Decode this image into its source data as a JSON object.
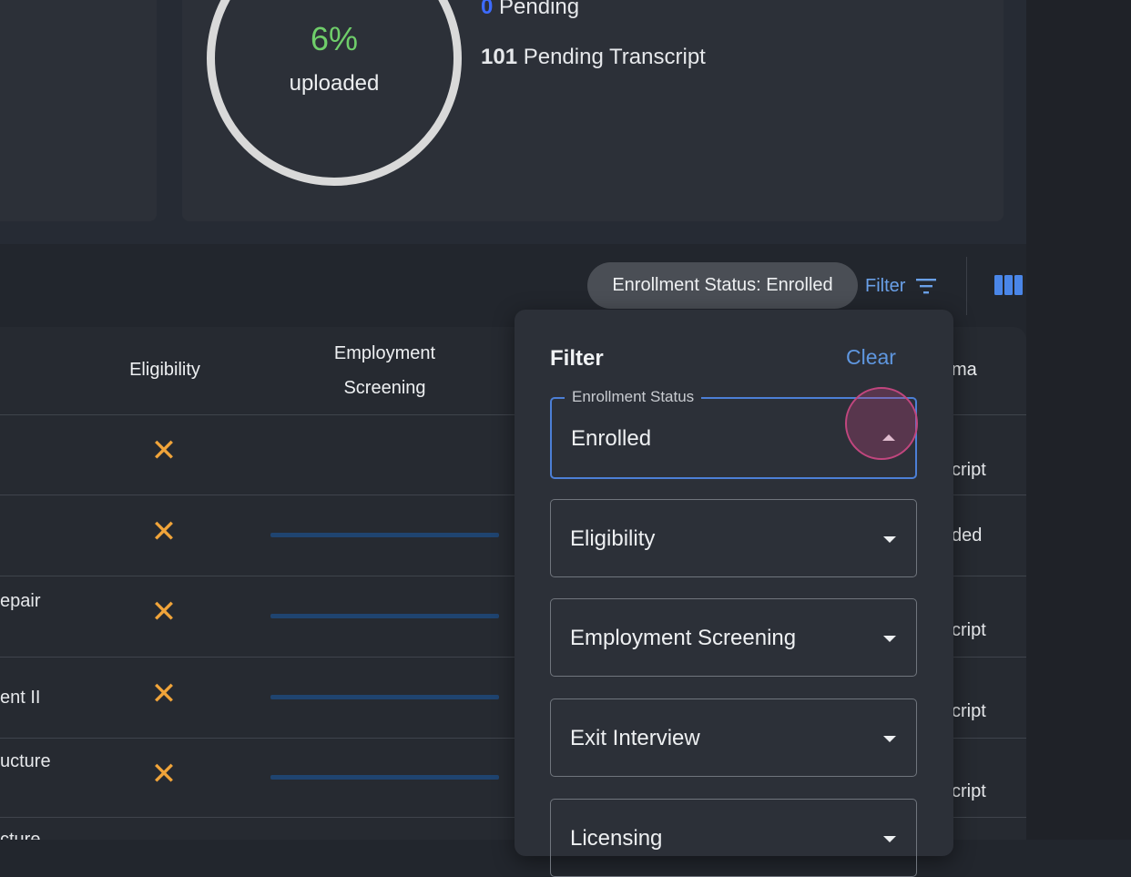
{
  "summary": {
    "progress_percent": "6%",
    "progress_value": 0.06,
    "progress_label": "uploaded",
    "pending_count": "0",
    "pending_label": "Pending",
    "pending_transcript_count": "101",
    "pending_transcript_label": "Pending Transcript"
  },
  "toolbar": {
    "chip_label": "Enrollment Status: Enrolled",
    "filter_label": "Filter",
    "filter_icon": "filter-list-icon",
    "columns_icon": "view-columns-icon"
  },
  "table": {
    "headers": {
      "eligibility": "Eligibility",
      "employment_screening_line1": "Employment",
      "employment_screening_line2": "Screening",
      "partial_right": "ma"
    },
    "rows": [
      {
        "left": "",
        "eligibility_icon": "close-icon",
        "right": "cript"
      },
      {
        "left": "",
        "eligibility_icon": "close-icon",
        "right": "ded"
      },
      {
        "left": "epair",
        "eligibility_icon": "close-icon",
        "right": "cript"
      },
      {
        "left": "ent II",
        "eligibility_icon": "close-icon",
        "right": "cript"
      },
      {
        "left": "ucture",
        "eligibility_icon": "close-icon",
        "right": "cript"
      },
      {
        "left": "cture",
        "eligibility_icon": "close-icon",
        "right": ""
      }
    ]
  },
  "filter_panel": {
    "title": "Filter",
    "clear_label": "Clear",
    "fields": [
      {
        "legend": "Enrollment Status",
        "value": "Enrolled",
        "active": true
      },
      {
        "value": "Eligibility"
      },
      {
        "value": "Employment Screening"
      },
      {
        "value": "Exit Interview"
      },
      {
        "value": "Licensing"
      }
    ]
  },
  "colors": {
    "accent_blue": "#5f97e0",
    "progress_green": "#6fce6a",
    "warning_orange": "#f0a43a",
    "focus_pink": "#c1467e"
  }
}
